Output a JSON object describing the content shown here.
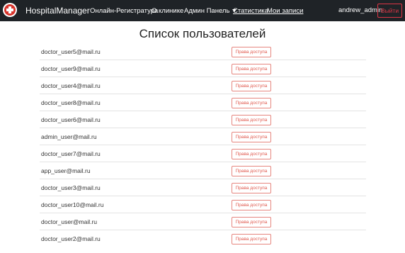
{
  "navbar": {
    "brand": "HospitalManager",
    "links": [
      {
        "label": "Онлайн-Регистратура",
        "name": "nav-online-registry"
      },
      {
        "label": "О клинике",
        "name": "nav-about-clinic"
      },
      {
        "label": "Админ Панель",
        "name": "nav-admin-panel"
      },
      {
        "label": "Статистика",
        "name": "nav-statistics"
      },
      {
        "label": "Мои записи",
        "name": "nav-my-records"
      }
    ],
    "username": "andrew_admin",
    "logout_label": "Выйти"
  },
  "page": {
    "title": "Список пользователей"
  },
  "users": [
    {
      "email": "doctor_user5@mail.ru",
      "action": "Права доступа"
    },
    {
      "email": "doctor_user9@mail.ru",
      "action": "Права доступа"
    },
    {
      "email": "doctor_user4@mail.ru",
      "action": "Права доступа"
    },
    {
      "email": "doctor_user8@mail.ru",
      "action": "Права доступа"
    },
    {
      "email": "doctor_user6@mail.ru",
      "action": "Права доступа"
    },
    {
      "email": "admin_user@mail.ru",
      "action": "Права доступа"
    },
    {
      "email": "doctor_user7@mail.ru",
      "action": "Права доступа"
    },
    {
      "email": "app_user@mail.ru",
      "action": "Права доступа"
    },
    {
      "email": "doctor_user3@mail.ru",
      "action": "Права доступа"
    },
    {
      "email": "doctor_user10@mail.ru",
      "action": "Права доступа"
    },
    {
      "email": "doctor_user@mail.ru",
      "action": "Права доступа"
    },
    {
      "email": "doctor_user2@mail.ru",
      "action": "Права доступа"
    }
  ],
  "colors": {
    "navbar_bg": "#1f2327",
    "danger": "#dc3545",
    "access_button": "#e05a4f"
  }
}
